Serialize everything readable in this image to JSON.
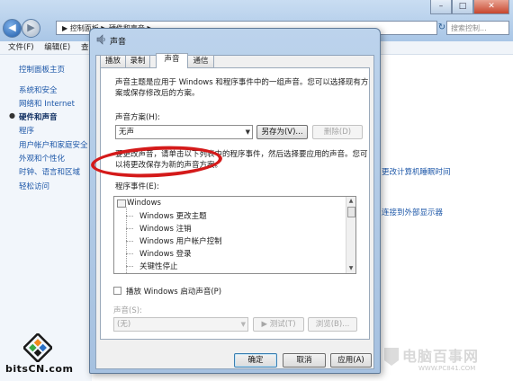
{
  "explorer": {
    "breadcrumb": "▶ 控制面板 ▶ 硬件和声音 ▶",
    "search_placeholder": "搜索控制...",
    "refresh_icon": "refresh-icon",
    "menu": [
      "文件(F)",
      "编辑(E)",
      "查看"
    ],
    "sidebar": {
      "home": "控制面板主页",
      "items": [
        "系统和安全",
        "网络和 Internet",
        "硬件和声音",
        "程序",
        "用户帐户和家庭安全",
        "外观和个性化",
        "时钟、语言和区域",
        "轻松访问"
      ],
      "current_index": 2
    },
    "links": [
      "更改计算机睡眠时间",
      "连接到外部显示器"
    ]
  },
  "dialog": {
    "title": "声音",
    "tabs": [
      "播放",
      "录制",
      "声音",
      "通信"
    ],
    "active_tab": 2,
    "intro_text": [
      "声音主题是应用于 Windows 和程序事件中的一组声音。您可以选择现有方",
      "案或保存修改后的方案。"
    ],
    "scheme_label": "声音方案(H):",
    "scheme_value": "无声",
    "save_as_button": "另存为(V)...",
    "delete_button": "删除(D)",
    "change_text": [
      "要更改声音，请单击以下列表中的程序事件，然后选择要应用的声音。您可",
      "以将更改保存为新的声音方案。"
    ],
    "events_label": "程序事件(E):",
    "events_root": "Windows",
    "events": [
      "Windows 更改主题",
      "Windows 注销",
      "Windows 用户帐户控制",
      "Windows 登录",
      "关键性停止"
    ],
    "startup_checkbox_label": "播放 Windows 启动声音(P)",
    "startup_checked": false,
    "sound_label": "声音(S):",
    "sound_value": "(无)",
    "test_button": "▶ 测试(T)",
    "browse_button": "浏览(B)...",
    "ok_button": "确定",
    "cancel_button": "取消",
    "apply_button": "应用(A)"
  },
  "watermark_left": "bitsCN.com",
  "watermark_right": {
    "big": "电脑百事网",
    "url": "WWW.PC841.COM"
  },
  "colors": {
    "highlight_ellipse": "#d41a1a",
    "link": "#1d57a8"
  }
}
